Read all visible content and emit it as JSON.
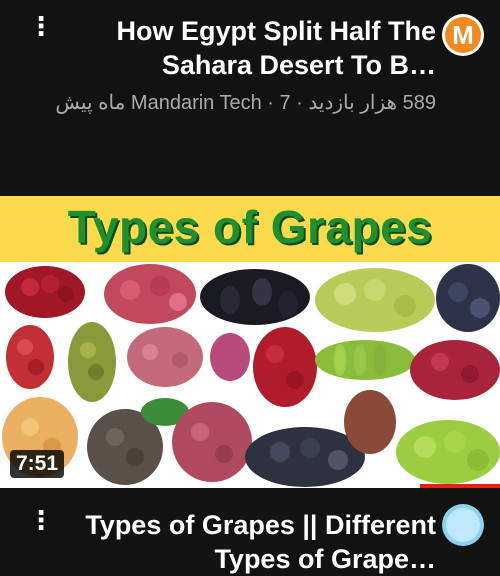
{
  "video1": {
    "title": "How Egypt Split Half The Sahara Desert To B…",
    "meta": "589 هزار بازدید · Mandarin Tech · 7 ماه پیش",
    "avatar_letter": "M"
  },
  "video2": {
    "thumbnail_title": "Types of Grapes",
    "duration": "7:51",
    "title": "Types of Grapes || Different Types of Grape…",
    "progress_fraction": 0.16
  },
  "colors": {
    "background": "#121212",
    "banner": "#fdd94c",
    "banner_text": "#1f8f2f",
    "progress": "#e62117"
  },
  "icons": [
    "more-vert-icon",
    "channel-avatar"
  ]
}
